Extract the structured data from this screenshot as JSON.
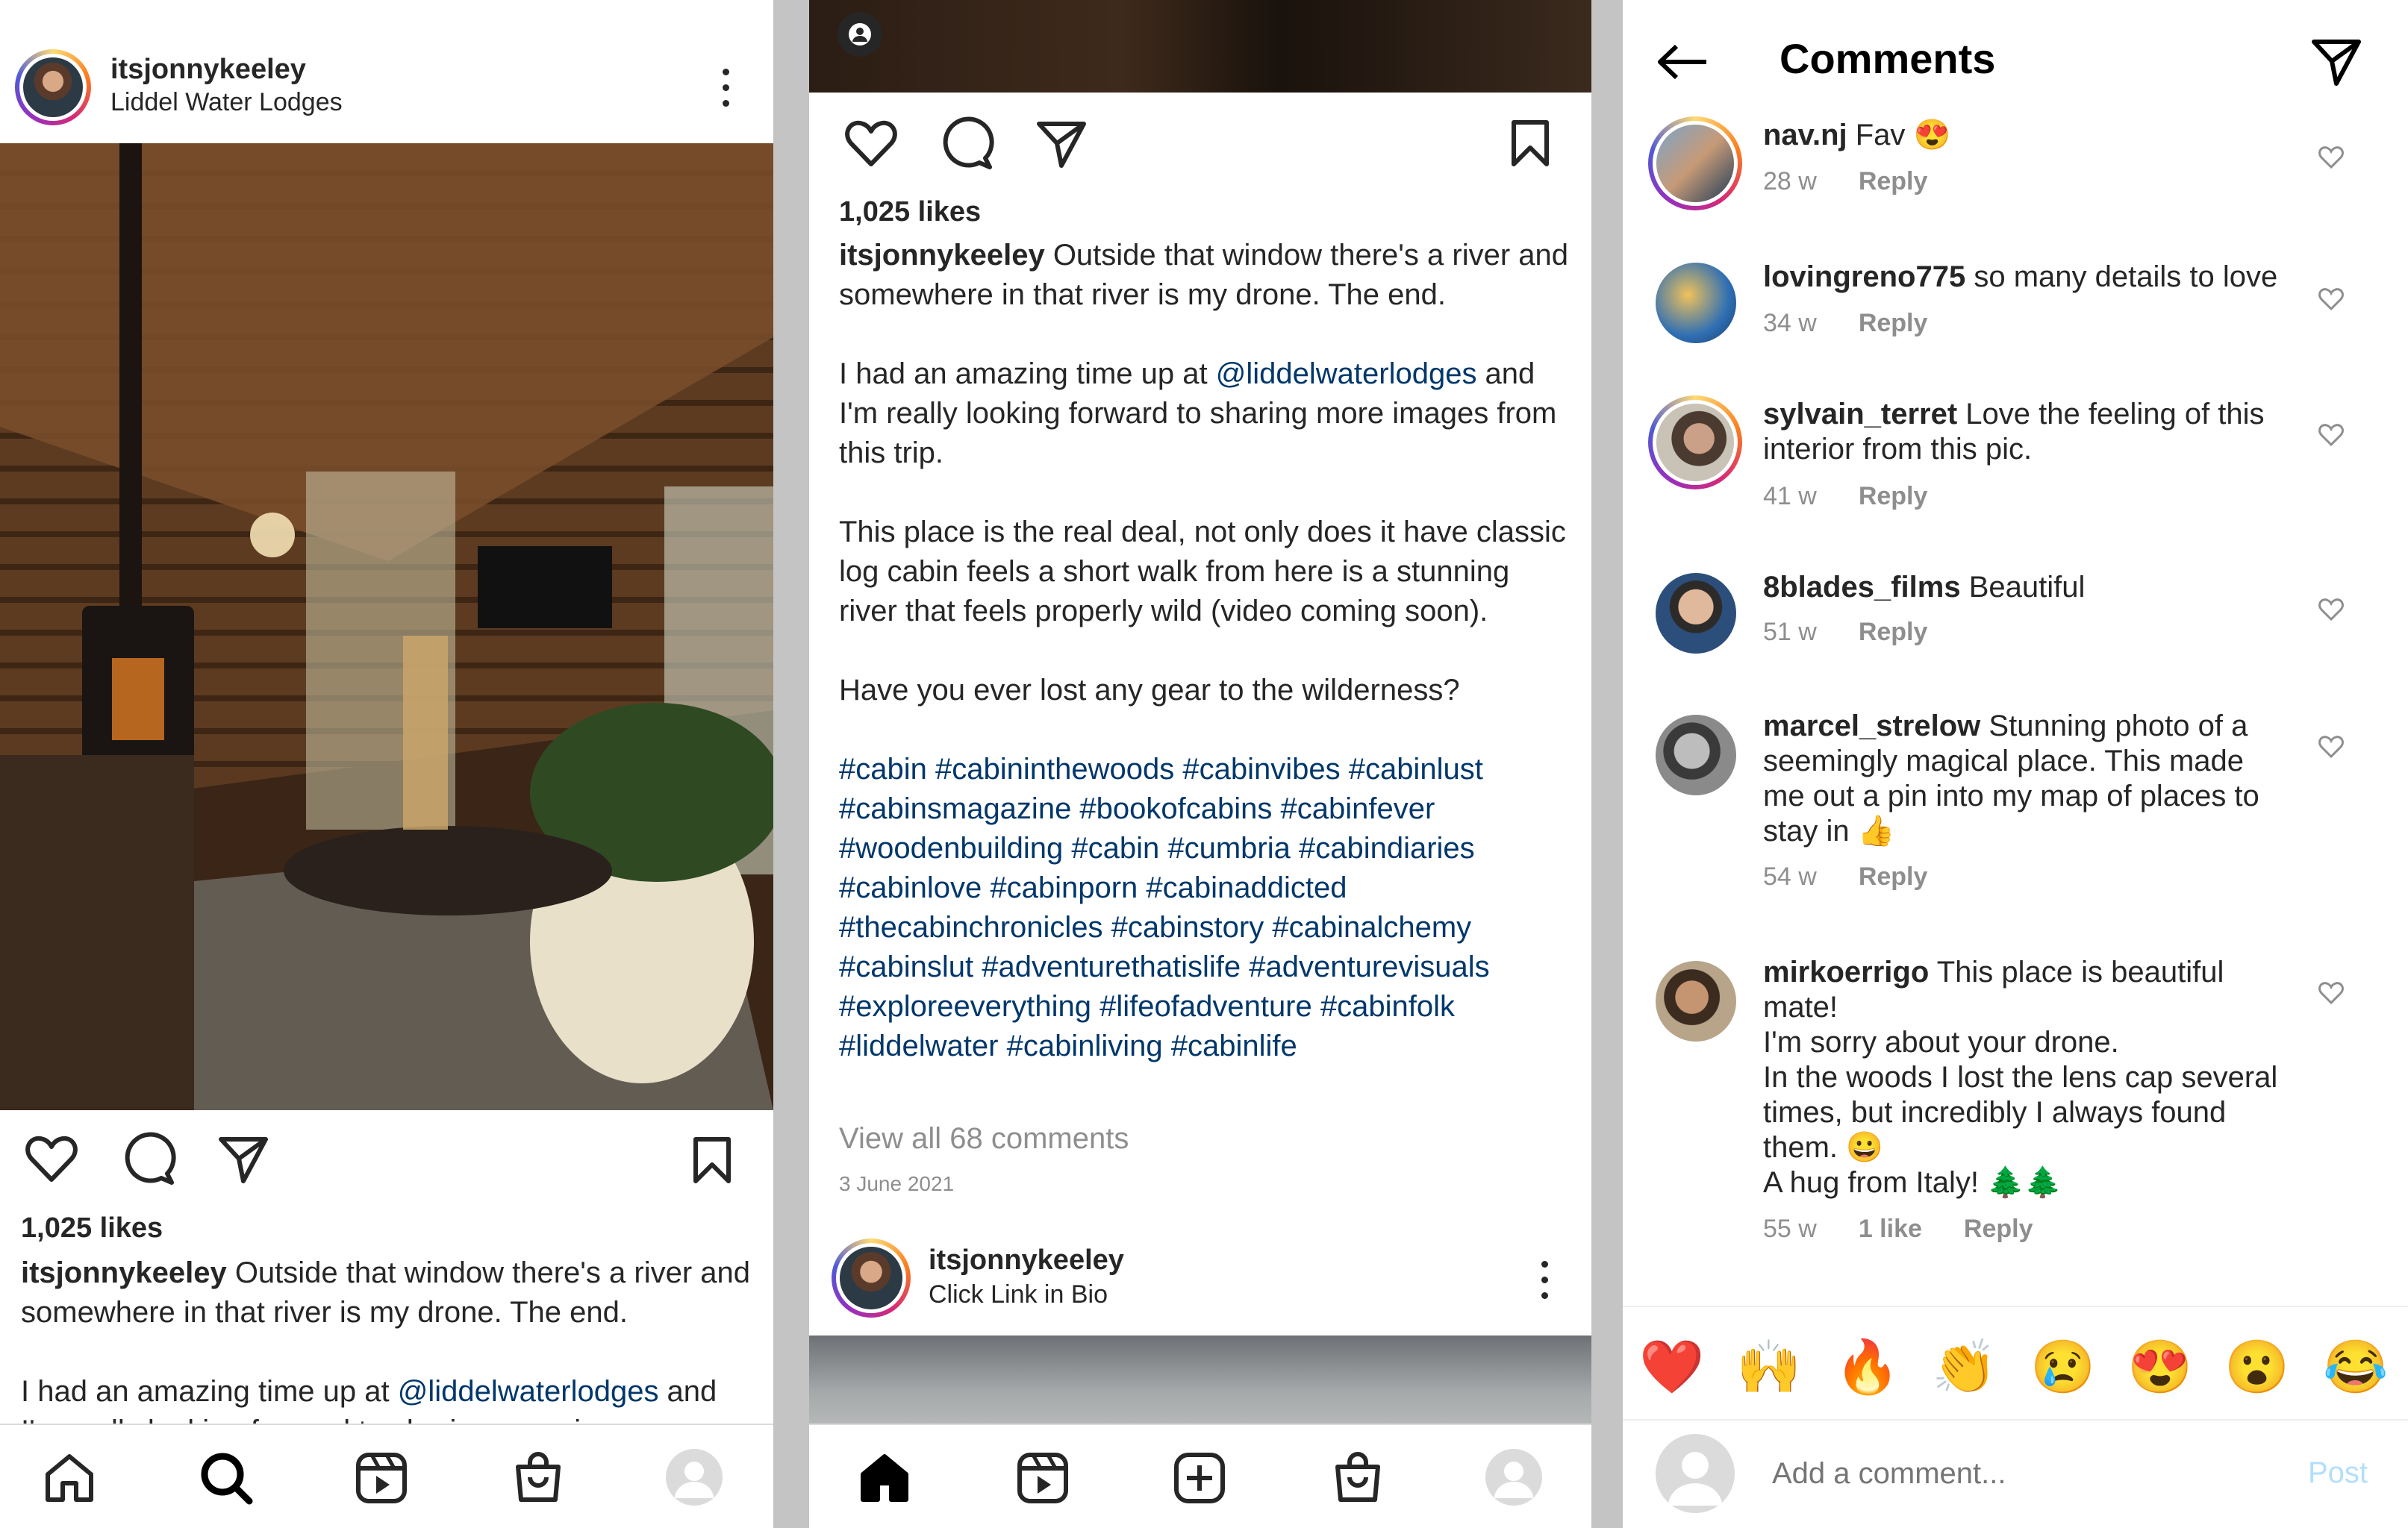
{
  "panel_left": {
    "header": {
      "username": "itsjonnykeeley",
      "location": "Liddel Water Lodges"
    },
    "likes": "1,025 likes",
    "caption_user": "itsjonnykeeley",
    "caption_line1": "Outside that window there's a river and",
    "caption_line2": "somewhere in that river is my drone. The end.",
    "caption_line3_pre": "I had an amazing time up at ",
    "caption_mention": "@liddelwaterlodges",
    "caption_line3_post": " and",
    "caption_line4_partial": "I'm really looking forward to sharing more images"
  },
  "panel_middle": {
    "likes": "1,025 likes",
    "caption_user": "itsjonnykeeley",
    "caption_p1": "Outside that window there's a river and somewhere in that river is my drone. The end.",
    "caption_p2_pre": "I had an amazing time up at ",
    "caption_p2_mention": "@liddelwaterlodges",
    "caption_p2_post": " and I'm really looking forward to sharing more images from this trip.",
    "caption_p3": "This place is the real deal, not only does it have classic log cabin feels a short walk from here is a stunning river that feels properly wild (video coming soon).",
    "caption_p4": "Have you ever lost any gear to the wilderness?",
    "hashtags": " #cabin #cabininthewoods #cabinvibes #cabinlust #cabinsmagazine #bookofcabins #cabinfever #woodenbuilding #cabin #cumbria #cabindiaries #cabinlove #cabinporn #cabinaddicted #thecabinchronicles #cabinstory #cabinalchemy #cabinslut #adventurethatislife #adventurevisuals #exploreeverything #lifeofadventure #cabinfolk #liddelwater #cabinliving #cabinlife",
    "view_all": "View all 68 comments",
    "date": "3 June 2021",
    "next_post": {
      "username": "itsjonnykeeley",
      "subtitle": "Click Link in Bio"
    }
  },
  "panel_right": {
    "title": "Comments",
    "reply_label": "Reply",
    "comments": [
      {
        "user": "nav.nj",
        "text": "Fav 😍",
        "age": "28 w"
      },
      {
        "user": "lovingreno775",
        "text": "so many details to love",
        "age": "34 w"
      },
      {
        "user": "sylvain_terret",
        "text": "Love the feeling of this interior from this pic.",
        "age": "41 w"
      },
      {
        "user": "8blades_films",
        "text": "Beautiful",
        "age": "51 w"
      },
      {
        "user": "marcel_strelow",
        "text": "Stunning photo of a seemingly magical place. This made me out a pin into my map of places to stay in 👍",
        "age": "54 w"
      },
      {
        "user": "mirkoerrigo",
        "text": "This place is beautiful mate!\nI'm sorry about your drone.\nIn the woods I lost the lens cap several times, but incredibly I always found them. 😀\nA hug from Italy! 🌲🌲",
        "age": "55 w",
        "likes": "1 like"
      }
    ],
    "emojis": [
      "❤️",
      "🙌",
      "🔥",
      "👏",
      "😢",
      "😍",
      "😮",
      "😂"
    ],
    "add_comment_placeholder": "Add a comment...",
    "post_label": "Post"
  },
  "colors": {
    "link": "#00376b",
    "muted": "#8e8e8e",
    "post_button": "#b2dffc",
    "text": "#262626"
  },
  "icons": [
    "heart-icon",
    "comment-icon",
    "share-icon",
    "bookmark-icon",
    "home-icon",
    "search-icon",
    "reels-icon",
    "shop-icon",
    "create-icon",
    "profile-icon",
    "back-icon",
    "more-icon"
  ]
}
